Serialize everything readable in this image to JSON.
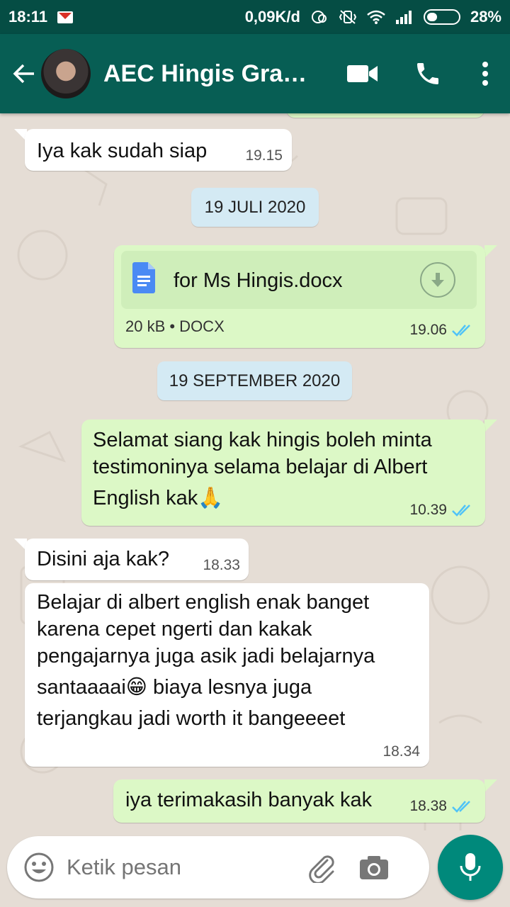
{
  "status_bar": {
    "time": "18:11",
    "net_speed": "0,09K/d",
    "battery": "28%",
    "icons": [
      "gmail-icon",
      "sync-icon",
      "vibrate-off-icon",
      "wifi-icon",
      "signal-icon",
      "battery-icon"
    ]
  },
  "header": {
    "title": "AEC Hingis Gram…",
    "icons": [
      "back-arrow-icon",
      "video-call-icon",
      "phone-icon",
      "more-vert-icon"
    ]
  },
  "messages": [
    {
      "type": "text",
      "dir": "in",
      "text": "Iya kak sudah siap",
      "time": "19.15"
    },
    {
      "type": "date",
      "text": "19 JULI 2020"
    },
    {
      "type": "doc",
      "dir": "out",
      "filename": "for Ms Hingis.docx",
      "meta": "20 kB • DOCX",
      "time": "19.06",
      "status": "read"
    },
    {
      "type": "date",
      "text": "19 SEPTEMBER 2020"
    },
    {
      "type": "text",
      "dir": "out",
      "lines": [
        "Selamat siang kak hingis boleh minta",
        "testimoninya selama belajar di Albert",
        "English kak🙏"
      ],
      "time": "10.39",
      "status": "read"
    },
    {
      "type": "text",
      "dir": "in",
      "text": "Disini aja kak?",
      "time": "18.33"
    },
    {
      "type": "text",
      "dir": "in",
      "lines": [
        "Belajar di albert english enak banget",
        "karena cepet ngerti dan kakak",
        "pengajarnya juga asik jadi belajarnya",
        "santaaaai😁 biaya lesnya juga",
        "terjangkau jadi worth it bangeeeet"
      ],
      "time": "18.34"
    },
    {
      "type": "text",
      "dir": "out",
      "text": "iya terimakasih banyak kak",
      "time": "18.38",
      "status": "read"
    }
  ],
  "input": {
    "placeholder": "Ketik pesan",
    "icons": [
      "emoji-icon",
      "attach-icon",
      "camera-icon",
      "mic-icon"
    ]
  },
  "colors": {
    "header": "#075e54",
    "status_bar": "#054d44",
    "outgoing_bubble": "#dcf8c6",
    "incoming_bubble": "#ffffff",
    "date_chip": "#d4eaf4",
    "read_ticks": "#4fc3f7",
    "mic_button": "#00897b"
  }
}
